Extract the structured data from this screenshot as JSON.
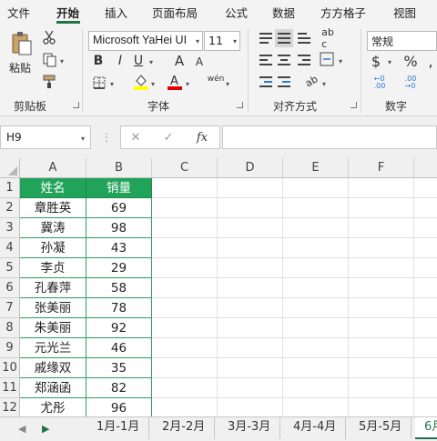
{
  "tabs": [
    "文件",
    "开始",
    "插入",
    "页面布局",
    "公式",
    "数据",
    "方方格子",
    "视图"
  ],
  "ribbon": {
    "clipboard": {
      "paste_label": "粘贴",
      "group_label": "剪贴板"
    },
    "font": {
      "name": "Microsoft YaHei UI",
      "size": "11",
      "bold": "B",
      "italic": "I",
      "underline": "U",
      "grow": "A",
      "shrink": "A",
      "phonetic": "wén",
      "group_label": "字体",
      "fill_color": "#ffff00",
      "font_color": "#e00000"
    },
    "alignment": {
      "group_label": "对齐方式"
    },
    "number": {
      "format": "常规",
      "currency": "$",
      "percent": "%",
      "group_label": "数字"
    }
  },
  "formula_bar": {
    "name_box": "H9",
    "cancel": "✕",
    "enter": "✓",
    "fx": "fx",
    "formula": ""
  },
  "columns": [
    "A",
    "B",
    "C",
    "D",
    "E",
    "F"
  ],
  "rows": [
    "1",
    "2",
    "3",
    "4",
    "5",
    "6",
    "7",
    "8",
    "9",
    "10",
    "11",
    "12"
  ],
  "table": {
    "headers": [
      "姓名",
      "销量"
    ],
    "data": [
      [
        "章胜英",
        "69"
      ],
      [
        "冀涛",
        "98"
      ],
      [
        "孙凝",
        "43"
      ],
      [
        "李贞",
        "29"
      ],
      [
        "孔春萍",
        "58"
      ],
      [
        "张美丽",
        "78"
      ],
      [
        "朱美丽",
        "92"
      ],
      [
        "元光兰",
        "46"
      ],
      [
        "戚缘双",
        "35"
      ],
      [
        "郑涵函",
        "82"
      ],
      [
        "尤彤",
        "96"
      ]
    ]
  },
  "sheets": [
    "1月-1月",
    "2月-2月",
    "3月-3月",
    "4月-4月",
    "5月-5月",
    "6月"
  ],
  "active_sheet": "6月",
  "colors": {
    "accent": "#217346",
    "header_fill": "#21a35a"
  }
}
